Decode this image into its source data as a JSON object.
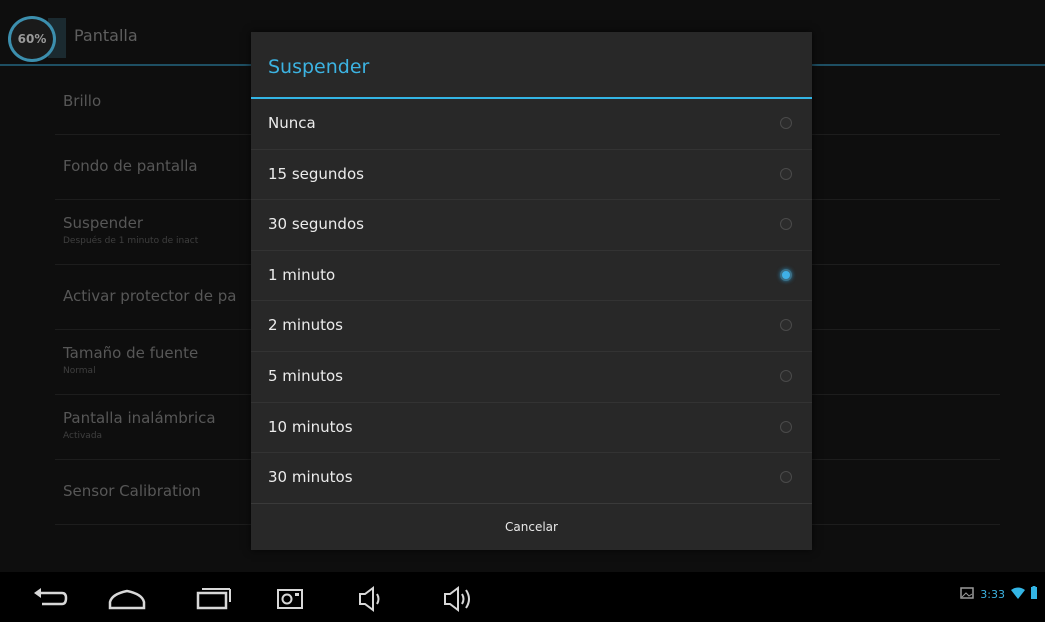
{
  "battery": {
    "percent_label": "60%"
  },
  "header": {
    "title": "Pantalla"
  },
  "settings": [
    {
      "title": "Brillo",
      "subtitle": ""
    },
    {
      "title": "Fondo de pantalla",
      "subtitle": ""
    },
    {
      "title": "Suspender",
      "subtitle": "Después de 1 minuto de inact"
    },
    {
      "title": "Activar protector de pa",
      "subtitle": ""
    },
    {
      "title": "Tamaño de fuente",
      "subtitle": "Normal"
    },
    {
      "title": "Pantalla inalámbrica",
      "subtitle": "Activada"
    },
    {
      "title": "Sensor Calibration",
      "subtitle": ""
    }
  ],
  "dialog": {
    "title": "Suspender",
    "options": [
      {
        "label": "Nunca",
        "checked": false
      },
      {
        "label": "15 segundos",
        "checked": false
      },
      {
        "label": "30 segundos",
        "checked": false
      },
      {
        "label": "1 minuto",
        "checked": true
      },
      {
        "label": "2 minutos",
        "checked": false
      },
      {
        "label": "5 minutos",
        "checked": false
      },
      {
        "label": "10 minutos",
        "checked": false
      },
      {
        "label": "30 minutos",
        "checked": false
      }
    ],
    "cancel_label": "Cancelar"
  },
  "nav_icons": [
    "back-icon",
    "home-icon",
    "recent-apps-icon",
    "screenshot-icon",
    "volume-down-icon",
    "volume-up-icon"
  ],
  "status": {
    "time": "3:33",
    "icons": [
      "gallery-notification-icon",
      "wifi-icon",
      "battery-icon"
    ]
  },
  "colors": {
    "accent": "#33b5e5",
    "dialog_bg": "#282828",
    "screen_bg": "#0e0e0e"
  }
}
